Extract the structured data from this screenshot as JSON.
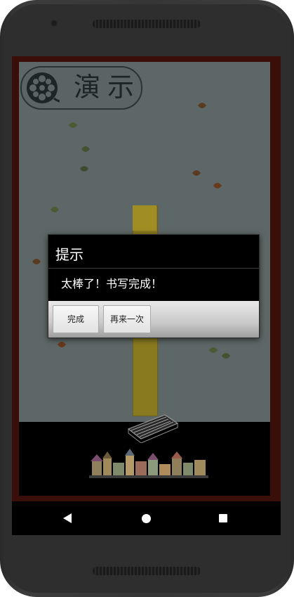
{
  "app": {
    "title": "演示"
  },
  "dialog": {
    "title": "提示",
    "message": "太棒了！书写完成！",
    "buttons": {
      "done_label": "完成",
      "retry_label": "再来一次"
    }
  },
  "navbar": {
    "back_icon": "back-triangle-icon",
    "home_icon": "home-circle-icon",
    "recent_icon": "recent-square-icon"
  },
  "colors": {
    "dialog_bg": "#000000",
    "overlay_app_bg": "#5e6767",
    "frame": "#3a0f0a",
    "ruler": "#8a7a1f"
  }
}
